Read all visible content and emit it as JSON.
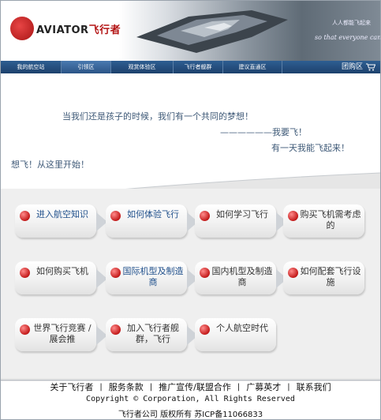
{
  "header": {
    "logo_brand": "AVIATOR",
    "logo_cn": "飞行者",
    "slogan_cn": "人人都能飞起来",
    "slogan_en": "so that everyone can fly"
  },
  "nav": {
    "items": [
      {
        "label": "我的航空站"
      },
      {
        "label": "引领区"
      },
      {
        "label": "观赏体验区"
      },
      {
        "label": "飞行者舰群"
      },
      {
        "label": "建议直通区"
      }
    ],
    "cart_label": "团购区"
  },
  "intro": {
    "line1": "当我们还是孩子的时候，我们有一个共同的梦想！",
    "line2": "——————我要飞！",
    "line3": "有一天我能飞起来！",
    "line4": "想飞！从这里开始！"
  },
  "tiles": [
    {
      "label": "进入航空知识",
      "blue": true
    },
    {
      "label": "如何体验飞行",
      "blue": true
    },
    {
      "label": "如何学习飞行",
      "blue": false
    },
    {
      "label": "购买飞机需考虑的",
      "blue": false
    },
    {
      "label": "如何购买飞机",
      "blue": false
    },
    {
      "label": "国际机型及制造商",
      "blue": true
    },
    {
      "label": "国内机型及制造商",
      "blue": false
    },
    {
      "label": "如何配套飞行设施",
      "blue": false
    },
    {
      "label": "世界飞行竞赛 / 展会推",
      "blue": false
    },
    {
      "label": "加入飞行者舰群，飞行",
      "blue": false
    },
    {
      "label": "个人航空时代",
      "blue": false
    }
  ],
  "footer": {
    "links": [
      {
        "label": "关于飞行者"
      },
      {
        "label": "服务条款"
      },
      {
        "label": "推广宣传/联盟合作"
      },
      {
        "label": "广募英才"
      },
      {
        "label": "联系我们"
      }
    ],
    "separator": "|",
    "copyright": "Copyright © Corporation, All Rights Reserved",
    "company": "飞行者公司   版权所有   苏ICP备11066833"
  },
  "colors": {
    "nav_bg": "#1d416c",
    "brand_red": "#b31414",
    "intro_text": "#3f5a78",
    "tile_blue_text": "#1f4f8b"
  },
  "icons": [
    "logo-mark-icon",
    "ship-image",
    "cart-icon",
    "tile-bullet-icon",
    "tile-arrow-icon"
  ]
}
